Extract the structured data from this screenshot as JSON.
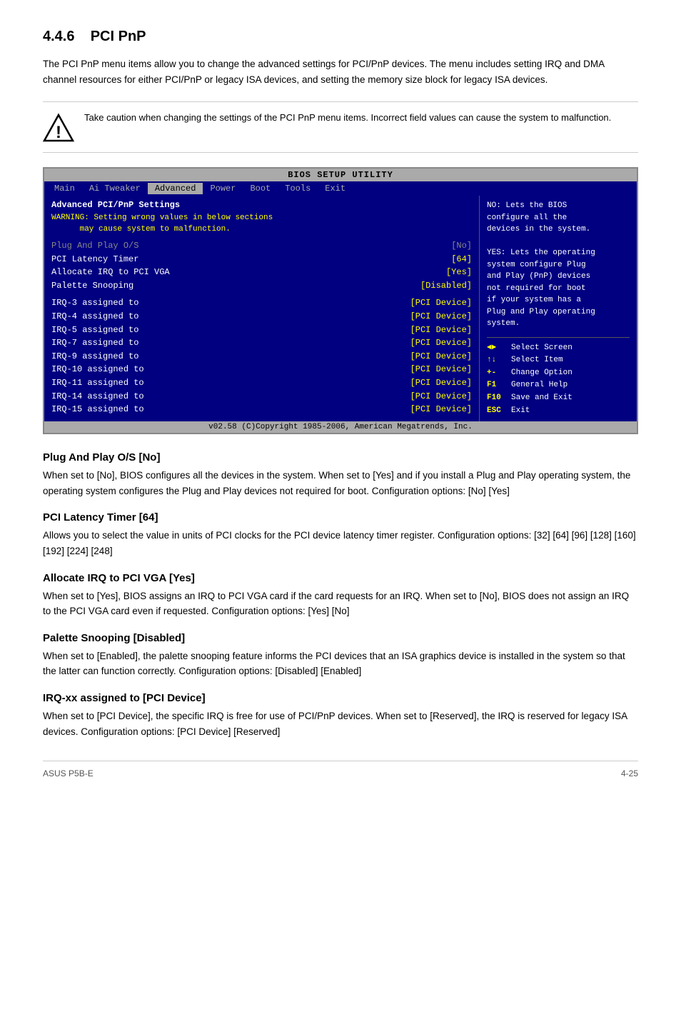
{
  "section": {
    "number": "4.4.6",
    "title": "PCI PnP",
    "intro": "The PCI PnP menu items allow you to change the advanced settings for PCI/PnP devices. The menu includes setting IRQ and DMA channel resources for either PCI/PnP or legacy ISA devices, and setting the memory size block for legacy ISA devices."
  },
  "warning": {
    "text": "Take caution when changing the settings of the PCI PnP menu items. Incorrect field values can cause the system to malfunction."
  },
  "bios": {
    "title": "BIOS SETUP UTILITY",
    "tabs": [
      "Main",
      "Ai Tweaker",
      "Advanced",
      "Power",
      "Boot",
      "Tools",
      "Exit"
    ],
    "active_tab": "Advanced",
    "section_header": "Advanced PCI/PnP Settings",
    "warning_line1": "WARNING: Setting wrong values in below sections",
    "warning_line2": "may cause system to malfunction.",
    "rows": [
      {
        "label": "Plug And Play O/S",
        "value": "[No]",
        "disabled": true
      },
      {
        "label": "PCI Latency Timer",
        "value": "[64]",
        "disabled": false
      },
      {
        "label": "Allocate IRQ to PCI VGA",
        "value": "[Yes]",
        "disabled": false
      },
      {
        "label": "Palette Snooping",
        "value": "[Disabled]",
        "disabled": false
      }
    ],
    "irq_rows": [
      {
        "label": "IRQ-3  assigned to",
        "value": "[PCI Device]"
      },
      {
        "label": "IRQ-4  assigned to",
        "value": "[PCI Device]"
      },
      {
        "label": "IRQ-5  assigned to",
        "value": "[PCI Device]"
      },
      {
        "label": "IRQ-7  assigned to",
        "value": "[PCI Device]"
      },
      {
        "label": "IRQ-9  assigned to",
        "value": "[PCI Device]"
      },
      {
        "label": "IRQ-10 assigned to",
        "value": "[PCI Device]"
      },
      {
        "label": "IRQ-11 assigned to",
        "value": "[PCI Device]"
      },
      {
        "label": "IRQ-14 assigned to",
        "value": "[PCI Device]"
      },
      {
        "label": "IRQ-15 assigned to",
        "value": "[PCI Device]"
      }
    ],
    "help_lines": [
      "NO: Lets the BIOS",
      "configure all the",
      "devices in the system.",
      "",
      "YES: Lets the operating",
      "system configure Plug",
      "and Play (PnP) devices",
      "not required for boot",
      "if your system has a",
      "Plug and Play operating",
      "system."
    ],
    "nav": [
      {
        "key": "◄►",
        "action": "Select Screen"
      },
      {
        "key": "↑↓",
        "action": "Select Item"
      },
      {
        "key": "+-",
        "action": "Change Option"
      },
      {
        "key": "F1",
        "action": "General Help"
      },
      {
        "key": "F10",
        "action": "Save and Exit"
      },
      {
        "key": "ESC",
        "action": "Exit"
      }
    ],
    "footer": "v02.58 (C)Copyright 1985-2006, American Megatrends, Inc."
  },
  "subsections": [
    {
      "id": "plug-and-play",
      "heading": "Plug And Play O/S [No]",
      "body": "When set to [No], BIOS configures all the devices in the system. When set to [Yes] and if you install a Plug and Play operating system, the operating system configures the Plug and Play devices not required for boot.\nConfiguration options: [No] [Yes]"
    },
    {
      "id": "pci-latency",
      "heading": "PCI Latency Timer [64]",
      "body": "Allows you to select the value in units of PCI clocks for the PCI device latency timer register. Configuration options: [32] [64] [96] [128] [160] [192] [224] [248]"
    },
    {
      "id": "allocate-irq",
      "heading": "Allocate IRQ to PCI VGA [Yes]",
      "body": "When set to [Yes], BIOS assigns an IRQ to PCI VGA card if the card requests for an IRQ. When set to [No], BIOS does not assign an IRQ to the PCI VGA card even if requested. Configuration options: [Yes] [No]"
    },
    {
      "id": "palette-snooping",
      "heading": "Palette Snooping [Disabled]",
      "body": "When set to [Enabled], the palette snooping feature informs the PCI devices that an ISA graphics device is installed in the system so that the latter can function correctly. Configuration options: [Disabled] [Enabled]"
    },
    {
      "id": "irq-assigned",
      "heading": "IRQ-xx assigned to [PCI Device]",
      "body": "When set to [PCI Device], the specific IRQ is free for use of PCI/PnP devices. When set to [Reserved], the IRQ is reserved for legacy ISA devices. Configuration options: [PCI Device] [Reserved]"
    }
  ],
  "footer": {
    "brand": "ASUS P5B-E",
    "page": "4-25"
  }
}
